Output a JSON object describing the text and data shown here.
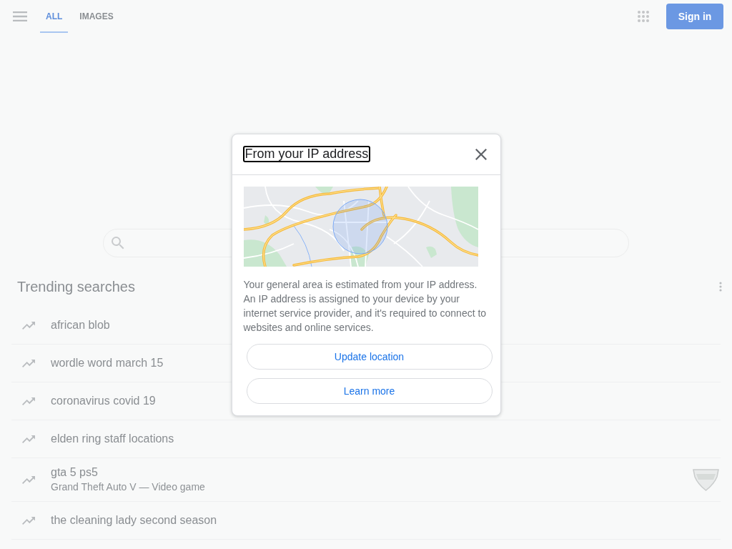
{
  "header": {
    "tabs": [
      {
        "label": "ALL",
        "selected": true
      },
      {
        "label": "IMAGES",
        "selected": false
      }
    ],
    "sign_in": "Sign in"
  },
  "trending": {
    "title": "Trending searches",
    "items": [
      {
        "kind": "query",
        "text": "african blob"
      },
      {
        "kind": "query",
        "text": "wordle word march 15"
      },
      {
        "kind": "query",
        "text": "coronavirus covid 19"
      },
      {
        "kind": "query",
        "text": "elden ring staff locations"
      },
      {
        "kind": "entity",
        "text": "gta 5 ps5",
        "subtitle": "Grand Theft Auto V — Video game"
      },
      {
        "kind": "query",
        "text": "the cleaning lady second season"
      }
    ]
  },
  "dialog": {
    "title": {
      "text": "From your IP address",
      "focused": true
    },
    "body": "Your general area is estimated from your IP address. An IP address is assigned to your device by your internet service provider, and it's required to connect to websites and online services.",
    "buttons": [
      "Update location",
      "Learn more"
    ]
  }
}
